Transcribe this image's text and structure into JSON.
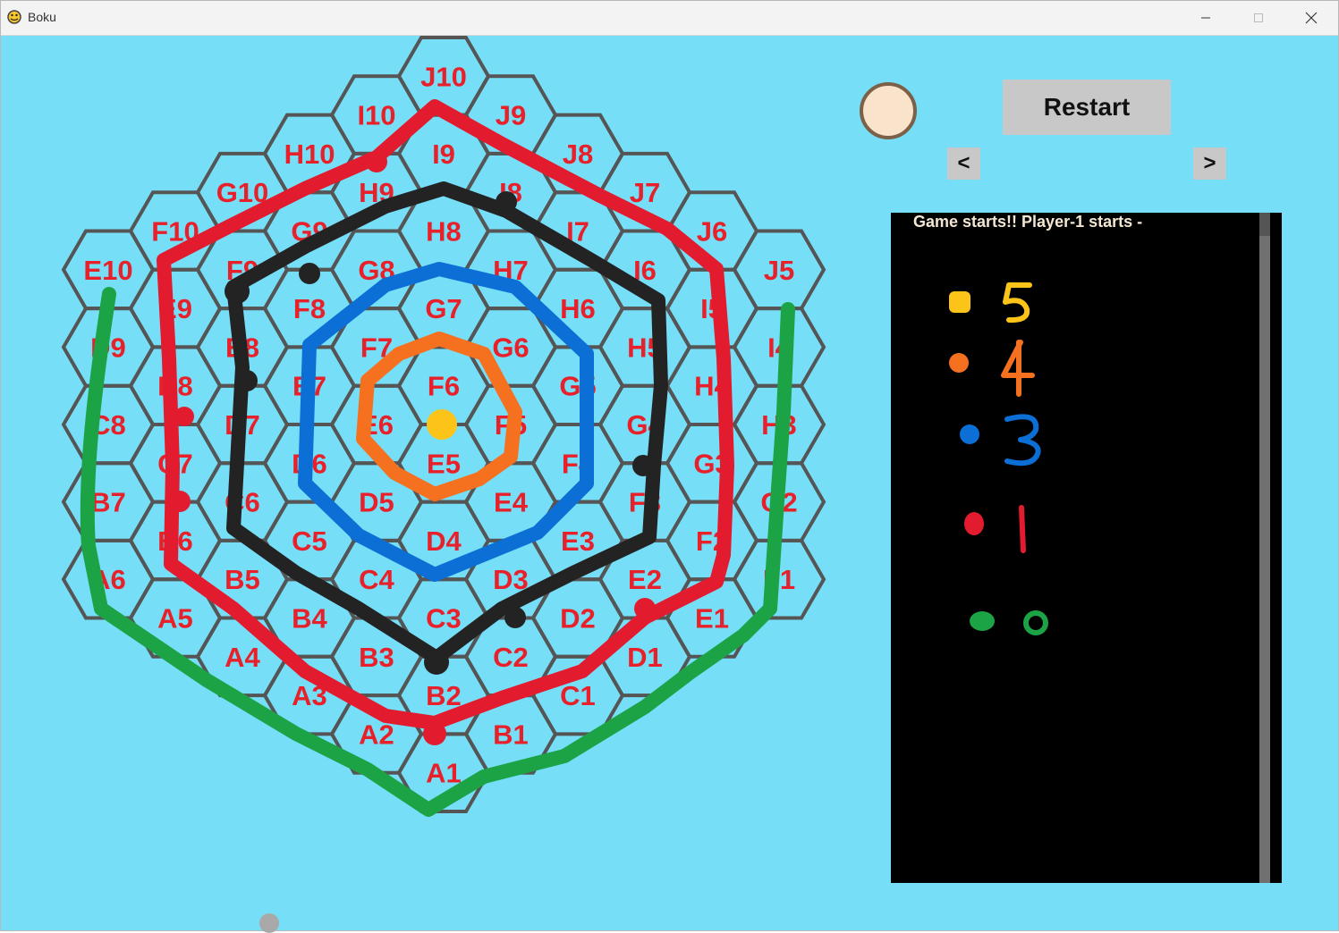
{
  "window": {
    "title": "Boku"
  },
  "controls": {
    "restart_label": "Restart",
    "prev_label": "<",
    "next_label": ">"
  },
  "log": {
    "lines": [
      "Game starts!! Player-1 starts -"
    ]
  },
  "board": {
    "cell_labels": [
      [
        "E10",
        "D9",
        "C8",
        "B7",
        "A6"
      ],
      [
        "F10",
        "E9",
        "D8",
        "C7",
        "B6",
        "A5"
      ],
      [
        "G10",
        "F9",
        "E8",
        "D7",
        "C6",
        "B5",
        "A4"
      ],
      [
        "H10",
        "G9",
        "F8",
        "E7",
        "D6",
        "C5",
        "B4",
        "A3"
      ],
      [
        "I10",
        "H9",
        "G8",
        "F7",
        "E6",
        "D5",
        "C4",
        "B3",
        "A2"
      ],
      [
        "J10",
        "I9",
        "H8",
        "G7",
        "F6",
        "E5",
        "D4",
        "C3",
        "B2",
        "A1"
      ],
      [
        "J9",
        "I8",
        "H7",
        "G6",
        "F5",
        "E4",
        "D3",
        "C2",
        "B1"
      ],
      [
        "J8",
        "I7",
        "H6",
        "G5",
        "F4",
        "E3",
        "D2",
        "C1"
      ],
      [
        "J7",
        "I6",
        "H5",
        "G4",
        "F3",
        "E2",
        "D1"
      ],
      [
        "J6",
        "I5",
        "H4",
        "G3",
        "F2",
        "E1"
      ],
      [
        "J5",
        "I4",
        "H3",
        "G2",
        "F1"
      ]
    ],
    "label_color": "#e8202a",
    "grid_color": "#555555"
  },
  "legend": [
    {
      "dot_color": "#fcc419",
      "number": "5",
      "number_color": "#fcc419"
    },
    {
      "dot_color": "#f57120",
      "number": "4",
      "number_color": "#f57120"
    },
    {
      "dot_color": "#0b6fd6",
      "number": "3",
      "number_color": "#0b6fd6"
    },
    {
      "dot_color": "#e31b2e",
      "number": "1",
      "number_color": "#e31b2e"
    },
    {
      "dot_color": "#1ba345",
      "number": "0",
      "number_color": "#1ba345"
    }
  ],
  "colors": {
    "background": "#76def7",
    "button": "#c8c8c8",
    "turn_piece": "#f9e3cb"
  }
}
